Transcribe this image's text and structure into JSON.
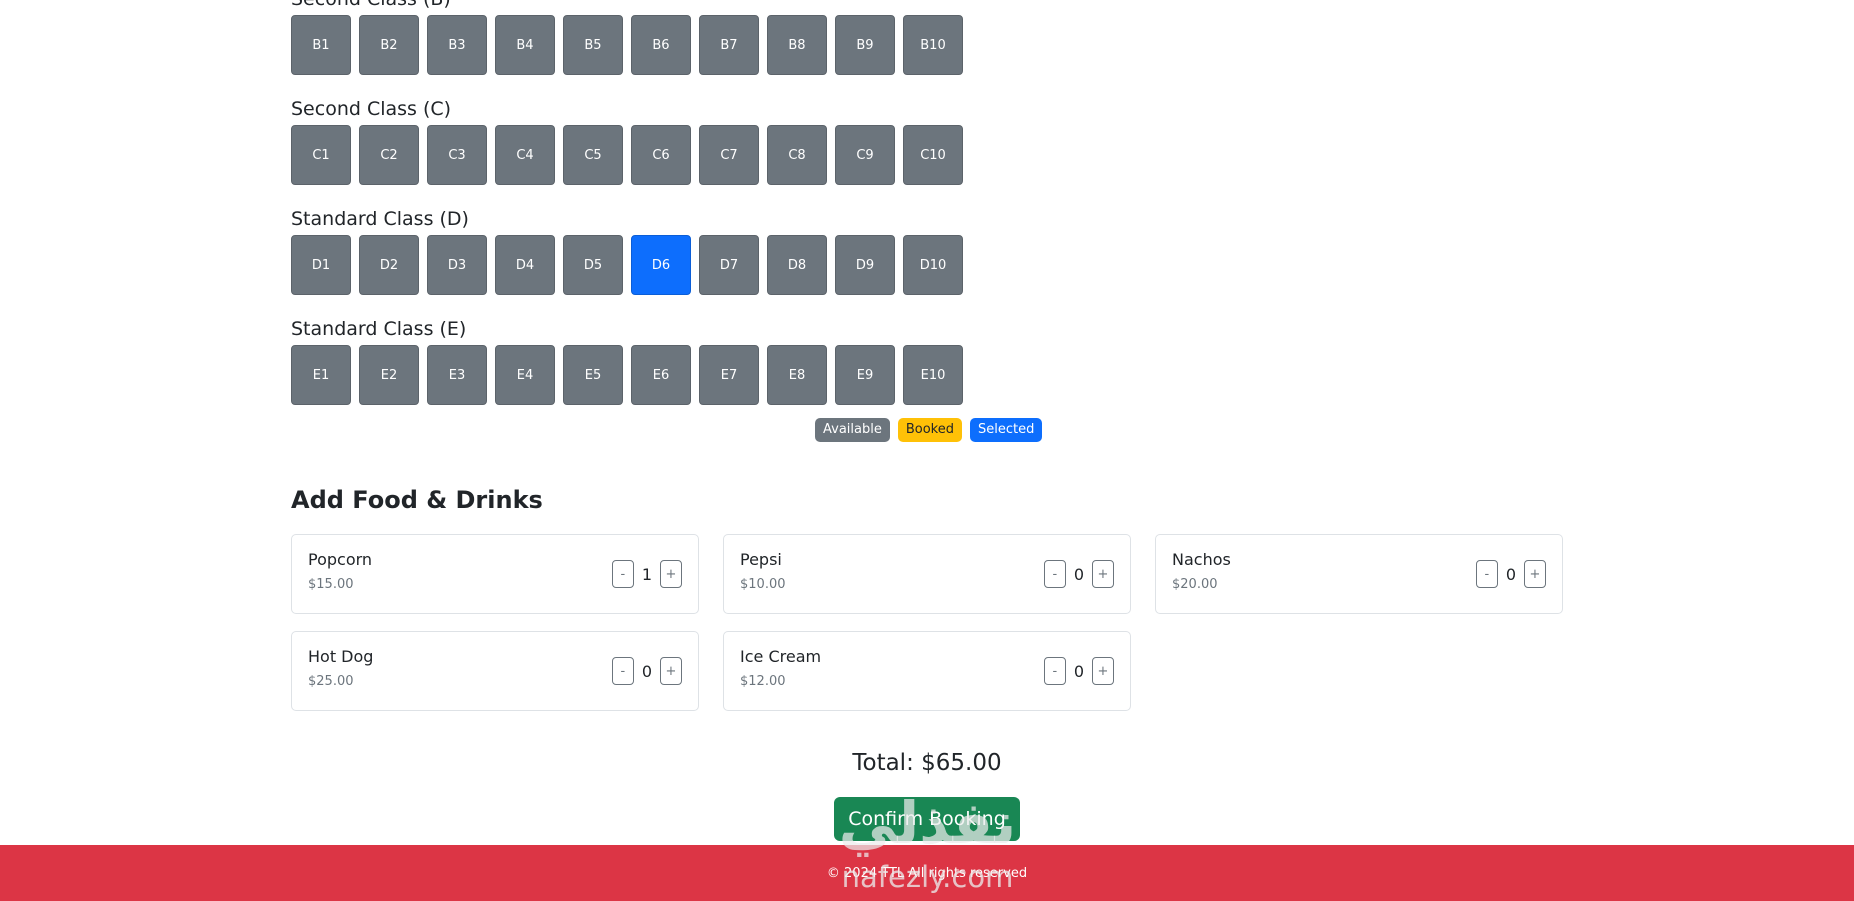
{
  "seat_sections": [
    {
      "title": "Second Class (B)",
      "seats": [
        "B1",
        "B2",
        "B3",
        "B4",
        "B5",
        "B6",
        "B7",
        "B8",
        "B9",
        "B10"
      ]
    },
    {
      "title": "Second Class (C)",
      "seats": [
        "C1",
        "C2",
        "C3",
        "C4",
        "C5",
        "C6",
        "C7",
        "C8",
        "C9",
        "C10"
      ]
    },
    {
      "title": "Standard Class (D)",
      "seats": [
        "D1",
        "D2",
        "D3",
        "D4",
        "D5",
        "D6",
        "D7",
        "D8",
        "D9",
        "D10"
      ]
    },
    {
      "title": "Standard Class (E)",
      "seats": [
        "E1",
        "E2",
        "E3",
        "E4",
        "E5",
        "E6",
        "E7",
        "E8",
        "E9",
        "E10"
      ]
    }
  ],
  "selected_seats": [
    "D6"
  ],
  "legend": {
    "available": "Available",
    "booked": "Booked",
    "selected": "Selected"
  },
  "food": {
    "title": "Add Food & Drinks",
    "items": [
      {
        "name": "Popcorn",
        "price": "$15.00",
        "qty": "1"
      },
      {
        "name": "Pepsi",
        "price": "$10.00",
        "qty": "0"
      },
      {
        "name": "Nachos",
        "price": "$20.00",
        "qty": "0"
      },
      {
        "name": "Hot Dog",
        "price": "$25.00",
        "qty": "0"
      },
      {
        "name": "Ice Cream",
        "price": "$12.00",
        "qty": "0"
      }
    ],
    "minus_label": "-",
    "plus_label": "+"
  },
  "total": "Total: $65.00",
  "confirm_label": "Confirm Booking",
  "footer_text": "© 2024 TTL All rights reserved",
  "watermark": {
    "arabic": "نفذلي",
    "latin": "nafezly.com"
  },
  "colors": {
    "seat_available": "#6c757d",
    "seat_selected": "#0d6efd",
    "booked": "#ffc107",
    "confirm": "#198754",
    "footer": "#dc3545"
  }
}
